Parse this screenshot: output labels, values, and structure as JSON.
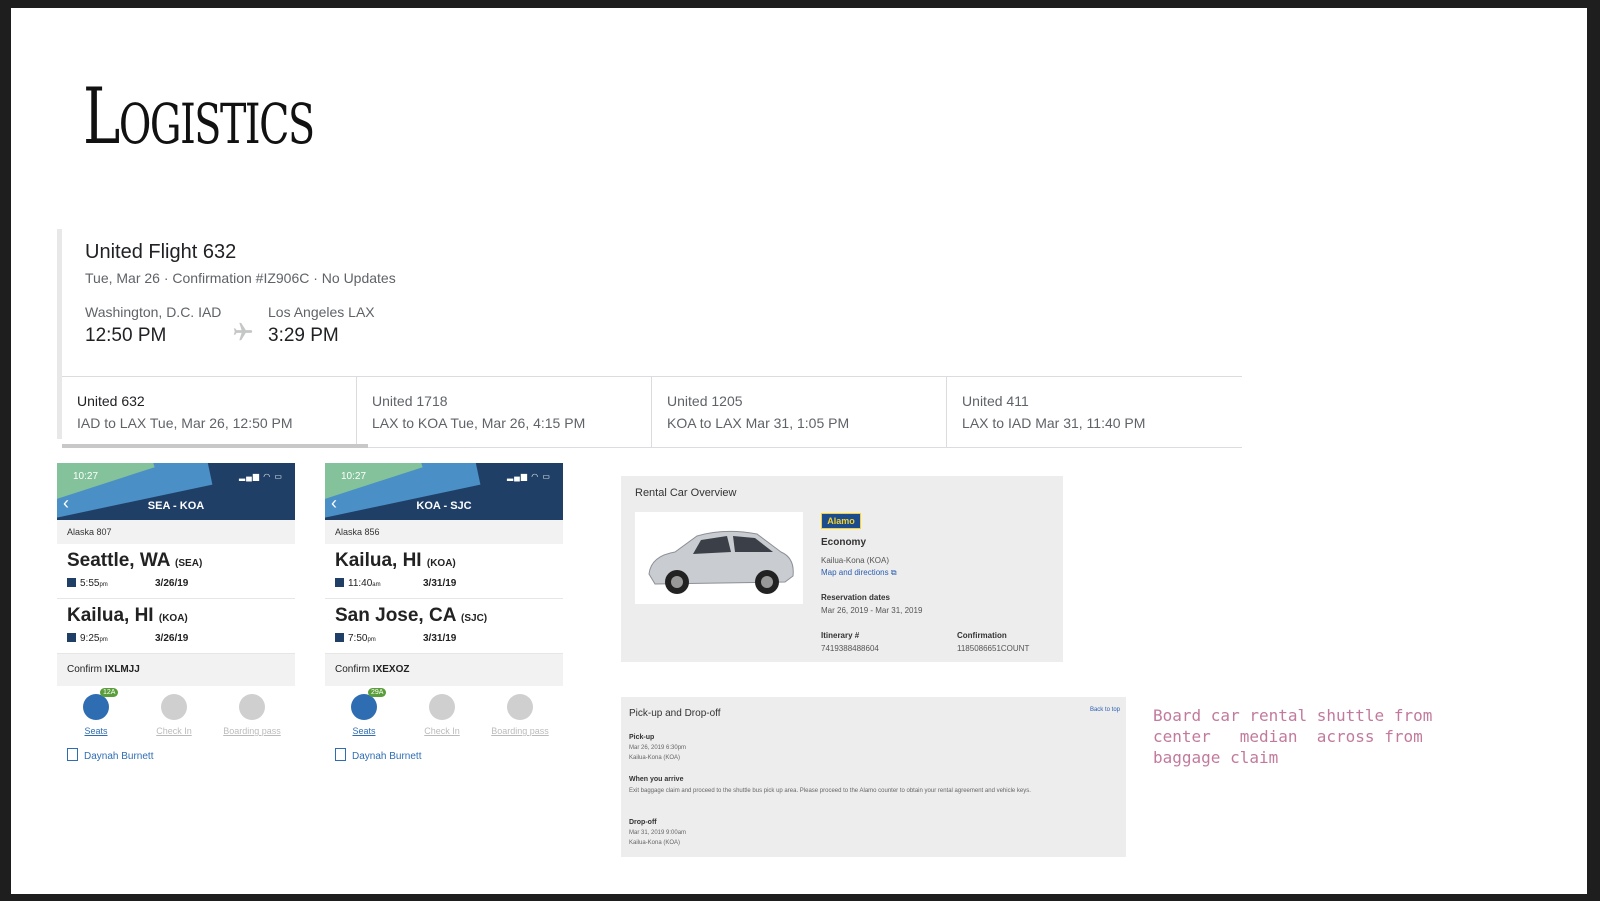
{
  "slide": {
    "title": "Logistics"
  },
  "flight": {
    "title": "United Flight 632",
    "subtitle": "Tue, Mar 26 · Confirmation #IZ906C · No Updates",
    "from_city": "Washington, D.C. IAD",
    "from_time": "12:50 PM",
    "to_city": "Los Angeles LAX",
    "to_time": "3:29 PM",
    "tabs": [
      {
        "name": "United 632",
        "detail": "IAD to LAX Tue, Mar 26, 12:50 PM"
      },
      {
        "name": "United 1718",
        "detail": "LAX to KOA Tue, Mar 26, 4:15 PM"
      },
      {
        "name": "United 1205",
        "detail": "KOA to LAX Mar 31, 1:05 PM"
      },
      {
        "name": "United 411",
        "detail": "LAX to IAD Mar 31, 11:40 PM"
      }
    ]
  },
  "phones": [
    {
      "time": "10:27",
      "route": "SEA - KOA",
      "flight": "Alaska 807",
      "legs": [
        {
          "city": "Seattle, WA",
          "code": "(SEA)",
          "time": "5:55",
          "ampm": "pm",
          "date": "3/26/19"
        },
        {
          "city": "Kailua, HI",
          "code": "(KOA)",
          "time": "9:25",
          "ampm": "pm",
          "date": "3/26/19"
        }
      ],
      "confirm_label": "Confirm",
      "confirm_code": "IXLMJJ",
      "seat_badge": "12A",
      "actions": [
        "Seats",
        "Check In",
        "Boarding pass"
      ],
      "passenger": "Daynah Burnett"
    },
    {
      "time": "10:27",
      "route": "KOA - SJC",
      "flight": "Alaska 856",
      "legs": [
        {
          "city": "Kailua, HI",
          "code": "(KOA)",
          "time": "11:40",
          "ampm": "am",
          "date": "3/31/19"
        },
        {
          "city": "San Jose, CA",
          "code": "(SJC)",
          "time": "7:50",
          "ampm": "pm",
          "date": "3/31/19"
        }
      ],
      "confirm_label": "Confirm",
      "confirm_code": "IXEXOZ",
      "seat_badge": "29A",
      "actions": [
        "Seats",
        "Check In",
        "Boarding pass"
      ],
      "passenger": "Daynah Burnett"
    }
  ],
  "rental": {
    "heading": "Rental Car Overview",
    "brand": "Alamo",
    "class": "Economy",
    "location": "Kailua-Kona (KOA)",
    "map_link": "Map and directions ⧉",
    "res_label": "Reservation dates",
    "res_dates": "Mar 26, 2019 - Mar 31, 2019",
    "itin_label": "Itinerary #",
    "itin_value": "7419388488604",
    "conf_label": "Confirmation",
    "conf_value": "1185086651COUNT"
  },
  "pickup": {
    "heading": "Pick-up and Drop-off",
    "back_to_top": "Back to top",
    "pickup_label": "Pick-up",
    "pickup_time": "Mar 26, 2019 6:30pm",
    "pickup_loc": "Kailua-Kona (KOA)",
    "arrive_label": "When you arrive",
    "arrive_text": "Exit baggage claim and proceed to the shuttle bus pick up area. Please proceed to the Alamo counter to obtain your rental agreement and vehicle keys.",
    "dropoff_label": "Drop-off",
    "dropoff_time": "Mar 31, 2019 9:00am",
    "dropoff_loc": "Kailua-Kona (KOA)"
  },
  "note": "Board car rental shuttle from center   median  across from baggage claim",
  "colors": {
    "phone_header": "#1f3f66",
    "accent_blue": "#2f6db3",
    "note": "#c27a9c"
  }
}
